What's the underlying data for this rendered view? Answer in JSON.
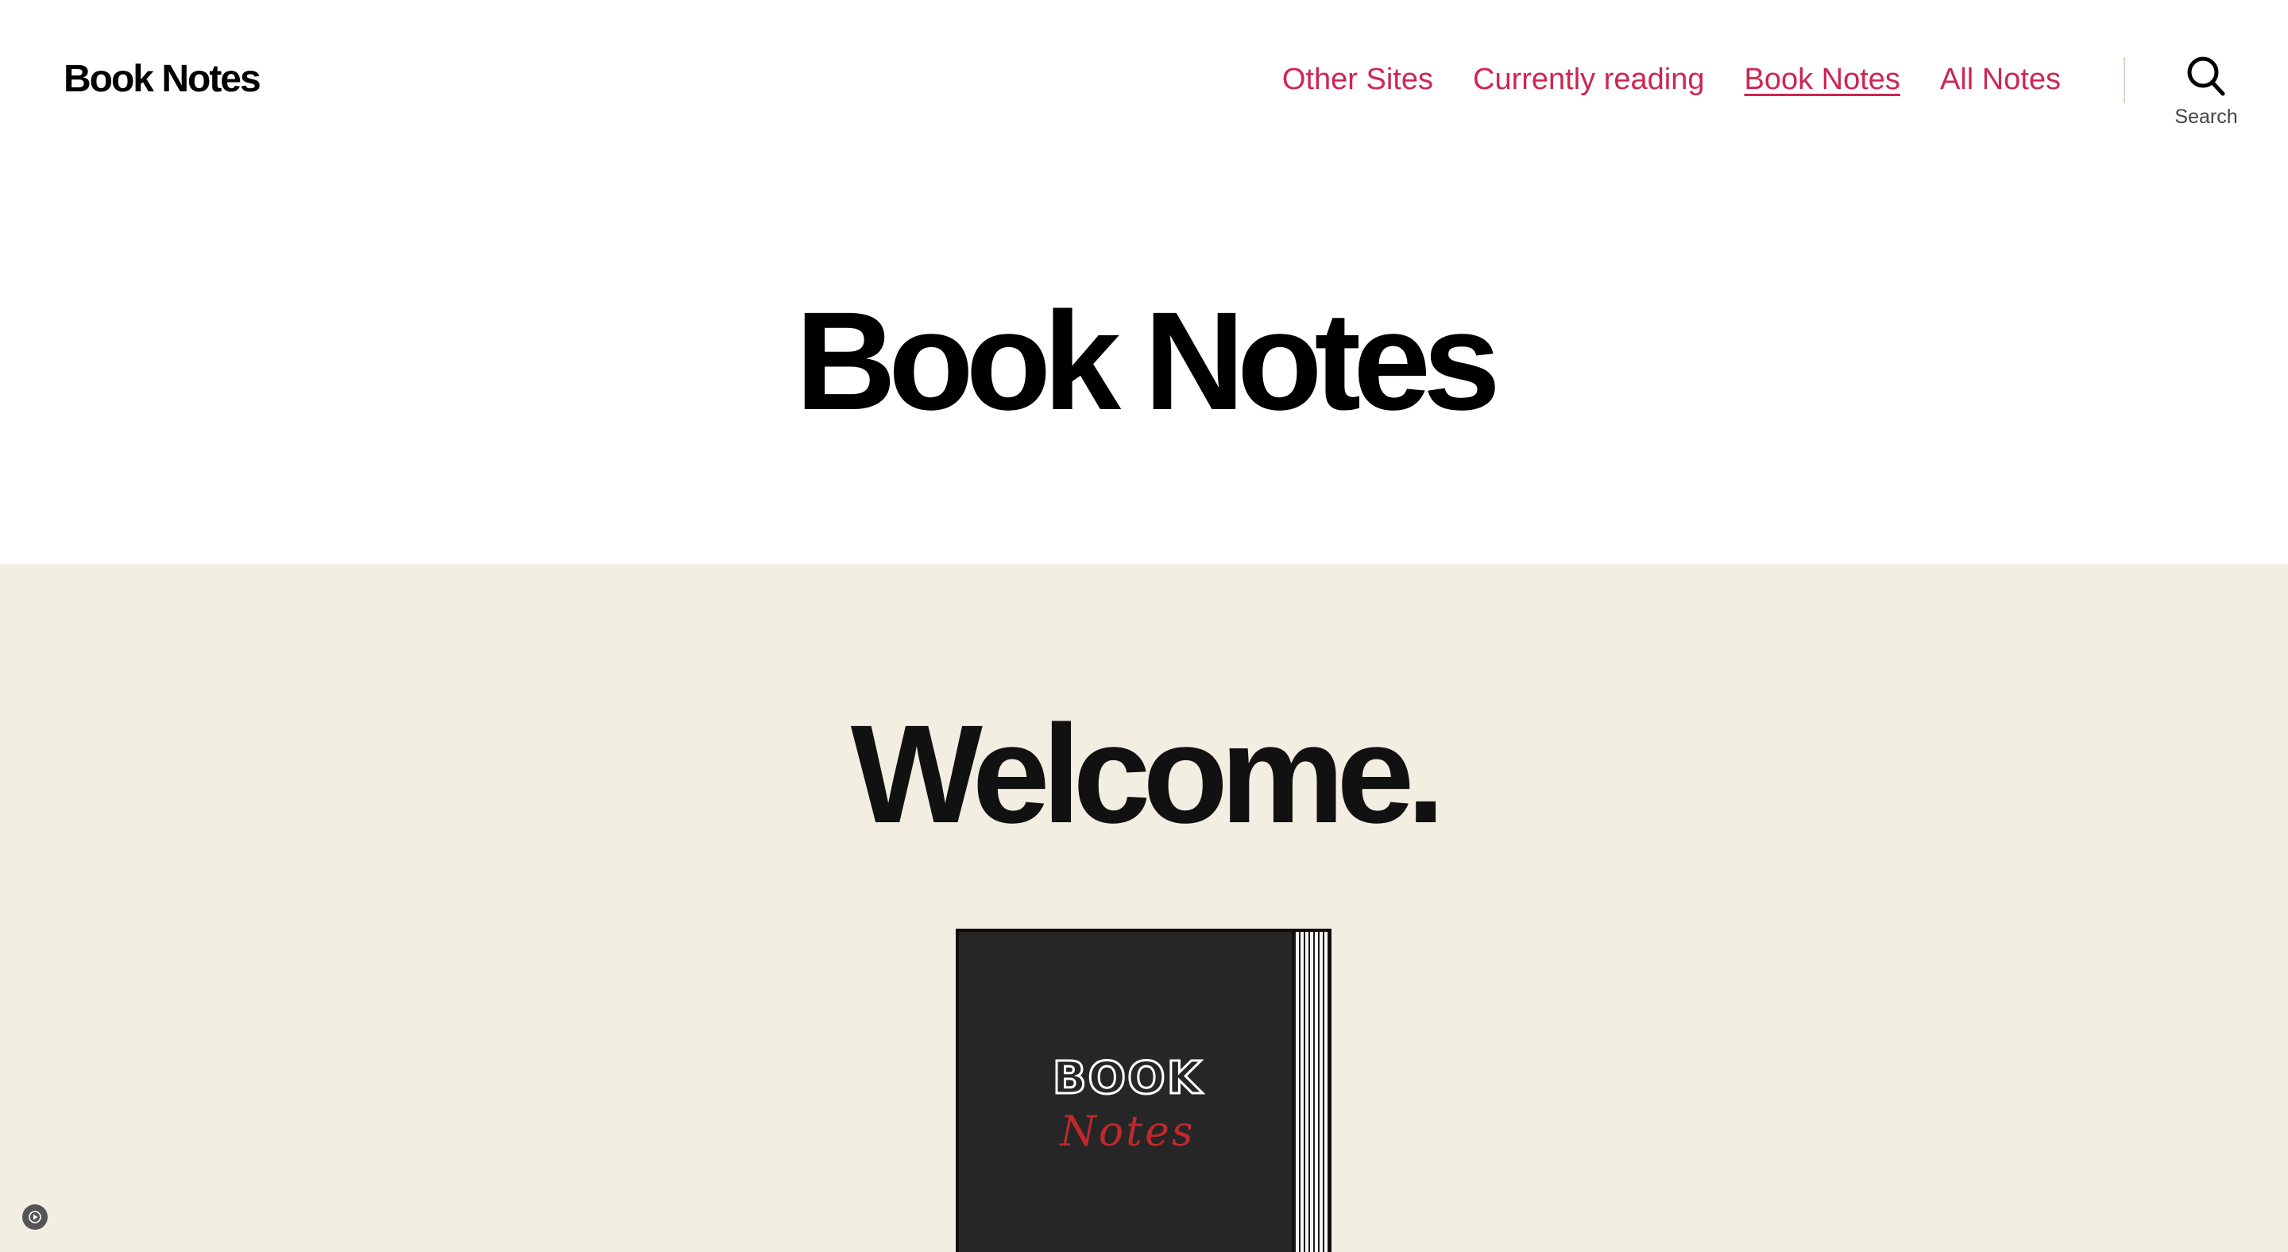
{
  "header": {
    "site_title": "Book Notes",
    "nav": [
      {
        "label": "Other Sites",
        "current": false
      },
      {
        "label": "Currently reading",
        "current": false
      },
      {
        "label": "Book Notes",
        "current": true
      },
      {
        "label": "All Notes",
        "current": false
      }
    ],
    "search_label": "Search",
    "search_icon": "search-icon"
  },
  "hero": {
    "title": "Book Notes"
  },
  "content": {
    "heading": "Welcome.",
    "cover_image": {
      "word1": "BOOK",
      "word2": "Notes"
    },
    "play_icon": "play-icon"
  },
  "colors": {
    "accent": "#cd2653",
    "content_bg": "#f3eee2",
    "cover_bg": "#262626",
    "cover_notes_text": "#c0282d"
  }
}
